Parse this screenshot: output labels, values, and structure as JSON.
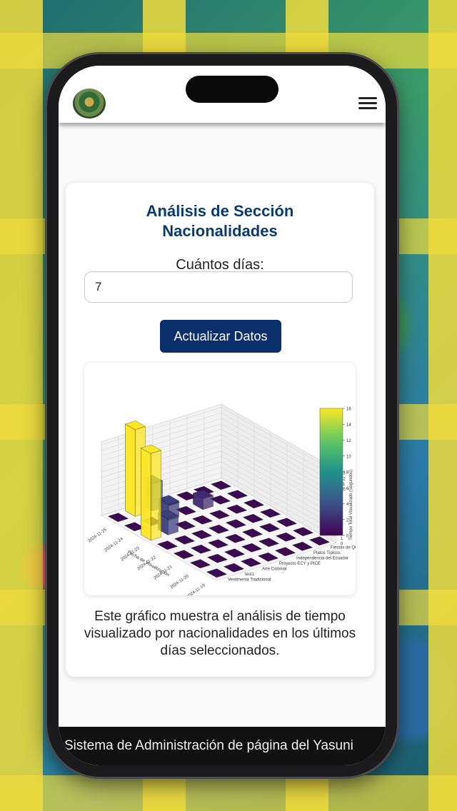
{
  "header": {
    "logo_icon": "yasuni-logo-icon",
    "menu_icon": "hamburger-menu-icon"
  },
  "card": {
    "title_line1": "Análisis de Sección",
    "title_line2": "Nacionalidades",
    "days_label": "Cuántos días:",
    "days_value": "7",
    "button_label": "Actualizar Datos",
    "description": "Este gráfico muestra el análisis de tiempo visualizado por nacionalidades en los últimos días seleccionados."
  },
  "chart_data": {
    "type": "bar",
    "subtype": "3d-bar",
    "xlabel": "Fecha de Visualización",
    "x_ticks": [
      "2024-11-25",
      "2024-11-24",
      "2024-11-23",
      "2024-11-22",
      "2024-11-21",
      "2024-11-20",
      "2024-11-19"
    ],
    "y_ticks": [
      "Fiestas de Quito",
      "Platos Típicos",
      "Independencia del Ecuador",
      "Proyecto ECY y PICE",
      "Arte Colonial",
      "test1",
      "Vestimenta Tradicional"
    ],
    "y_tick_suffix": "...",
    "zlabel": "Tiempo Total Visualizado (Segundos)",
    "z_ticks": [
      "0",
      "1",
      "2",
      "3",
      "4",
      "5",
      "6",
      "7",
      "8",
      "9",
      "10",
      "11",
      "12",
      "13"
    ],
    "colorbar_ticks": [
      "0",
      "2",
      "4",
      "6",
      "8",
      "10",
      "12",
      "14",
      "16"
    ],
    "colorbar_range": [
      0,
      16
    ],
    "bars": [
      {
        "x": 2,
        "y": 0,
        "value": 16
      },
      {
        "x": 0,
        "y": 1,
        "value": 16
      },
      {
        "x": 0,
        "y": 2,
        "value": 5
      },
      {
        "x": 2,
        "y": 1,
        "value": 3
      },
      {
        "x": 1,
        "y": 2,
        "value": 3
      },
      {
        "x": 1,
        "y": 4,
        "value": 2
      }
    ]
  },
  "footer": {
    "text": "Sistema de Administración de página del Yasuni"
  }
}
